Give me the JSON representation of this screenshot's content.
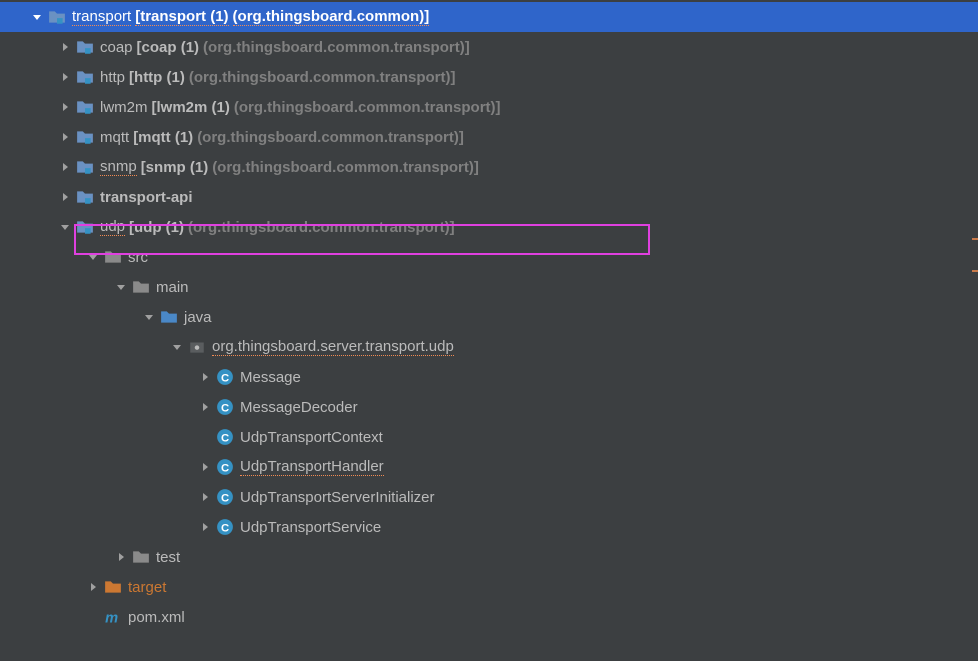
{
  "tree": {
    "transport": {
      "name": "transport",
      "module": "[transport (1)",
      "context": "(org.thingsboard.common)]",
      "children": {
        "coap": {
          "name": "coap",
          "module": "[coap (1)",
          "context": "(org.thingsboard.common.transport)]"
        },
        "http": {
          "name": "http",
          "module": "[http (1)",
          "context": "(org.thingsboard.common.transport)]"
        },
        "lwm2m": {
          "name": "lwm2m",
          "module": "[lwm2m (1)",
          "context": "(org.thingsboard.common.transport)]"
        },
        "mqtt": {
          "name": "mqtt",
          "module": "[mqtt (1)",
          "context": "(org.thingsboard.common.transport)]"
        },
        "snmp": {
          "name": "snmp",
          "module": "[snmp (1)",
          "context": "(org.thingsboard.common.transport)]"
        },
        "transport_api": {
          "name": "transport-api"
        },
        "udp": {
          "name": "udp",
          "module": "[udp (1)",
          "context": "(org.thingsboard.common.transport)]"
        }
      }
    },
    "src": {
      "name": "src"
    },
    "main": {
      "name": "main"
    },
    "java": {
      "name": "java"
    },
    "package": {
      "name": "org.thingsboard.server.transport.udp"
    },
    "classes": {
      "message": {
        "name": "Message"
      },
      "messageDecoder": {
        "name": "MessageDecoder"
      },
      "udpContext": {
        "name": "UdpTransportContext"
      },
      "udpHandler": {
        "name": "UdpTransportHandler"
      },
      "udpInit": {
        "name": "UdpTransportServerInitializer"
      },
      "udpService": {
        "name": "UdpTransportService"
      }
    },
    "test": {
      "name": "test"
    },
    "target": {
      "name": "target"
    },
    "pom": {
      "name": "pom.xml"
    }
  },
  "colors": {
    "folderBlue": "#6a91c2",
    "moduleBlue": "#4a88c7",
    "moduleDot": "#3592c4",
    "folderGray": "#8a8a8a",
    "folderOrange": "#cc7832",
    "classCircle": "#3592c4",
    "mFile": "#3592c4"
  }
}
